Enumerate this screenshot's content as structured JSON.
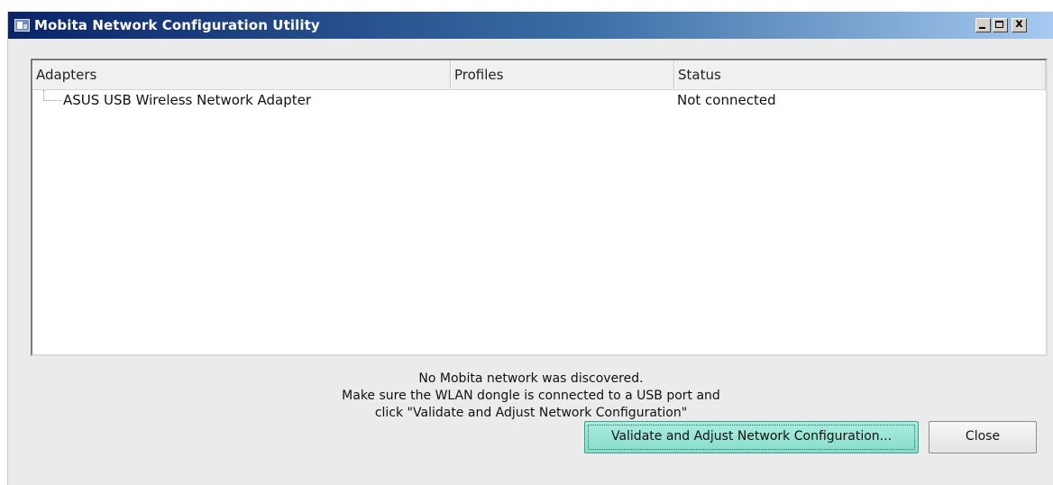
{
  "window": {
    "title": "Mobita Network Configuration Utility",
    "controls": {
      "minimize": "minimize-icon",
      "maximize": "maximize-icon",
      "close": "close-icon",
      "close_glyph": "x"
    }
  },
  "table": {
    "columns": [
      "Adapters",
      "Profiles",
      "Status"
    ],
    "rows": [
      {
        "adapter": "ASUS USB Wireless Network Adapter",
        "profile": "",
        "status": "Not connected"
      }
    ]
  },
  "message": {
    "line1": "No Mobita network was discovered.",
    "line2": "Make sure the WLAN dongle is connected to a USB port and",
    "line3": "click \"Validate and Adjust Network Configuration\""
  },
  "buttons": {
    "validate_label": "Validate and Adjust Network Configuration...",
    "close_label": "Close"
  },
  "colors": {
    "title_gradient_start": "#0a246a",
    "title_gradient_end": "#a6caf0",
    "validate_button": "#86ddc9",
    "window_background": "#ebebeb"
  }
}
